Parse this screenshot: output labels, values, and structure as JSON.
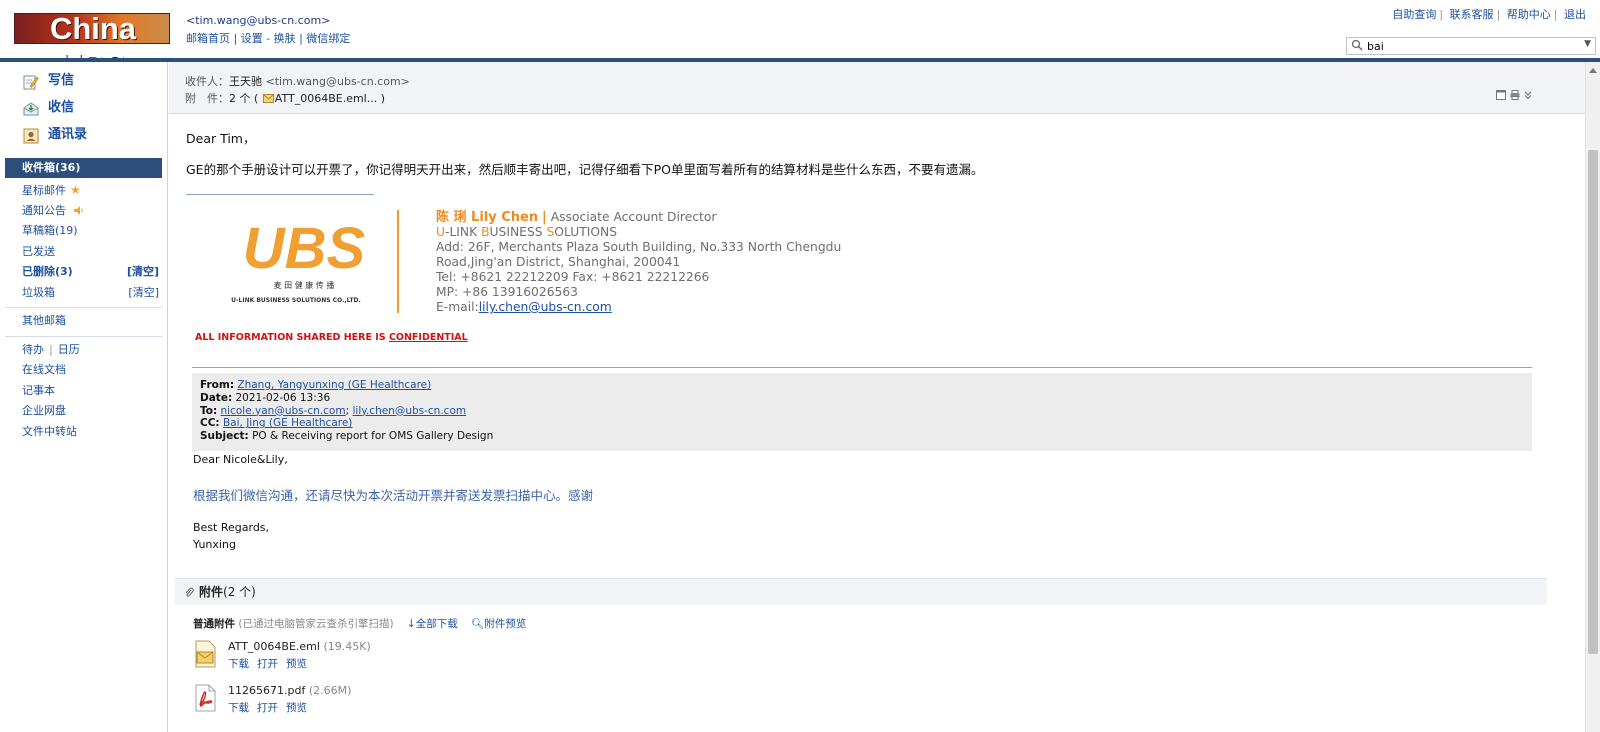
{
  "header": {
    "logo_text": "China UBS",
    "account_email": "<tim.wang@ubs-cn.com>",
    "account_links": [
      "邮箱首页",
      "设置",
      "换肤",
      "微信绑定"
    ],
    "top_links": [
      "自助查询",
      "联系客服",
      "帮助中心",
      "退出"
    ],
    "search": {
      "value": "bai"
    }
  },
  "sidebar": {
    "main": [
      "写信",
      "收信",
      "通讯录"
    ],
    "inbox": "收件箱(36)",
    "folders": [
      {
        "label": "星标邮件"
      },
      {
        "label": "通知公告"
      },
      {
        "label": "草稿箱(19)"
      },
      {
        "label": "已发送"
      },
      {
        "label": "已删除(3)",
        "clear": "[清空]"
      },
      {
        "label": "垃圾箱",
        "clear": "[清空]"
      }
    ],
    "others": "其他邮箱",
    "tools": {
      "todo": "待办",
      "calendar": "日历",
      "docs": "在线文档",
      "notes": "记事本",
      "disk": "企业网盘",
      "transfer": "文件中转站"
    }
  },
  "mail": {
    "recipient_label": "收件人：",
    "recipient_name": "王天驰",
    "recipient_email": "<tim.wang@ubs-cn.com>",
    "attachment_label": "附　件：",
    "attachment_count": "2 个 (",
    "attachment_name": "ATT_0064BE.eml...",
    "attachment_close": ")",
    "greeting": "Dear Tim，",
    "body": "GE的那个手册设计可以开票了，你记得明天开出来，然后顺丰寄出吧，记得仔细看下PO单里面写着所有的结算材料是些什么东西，不要有遗漏。",
    "signature": {
      "name": "陈 琍 Lily Chen",
      "sep": "|",
      "title": "Associate Account Director",
      "company_parts": [
        "U",
        "-LINK ",
        "B",
        "USINESS ",
        "S",
        "OLUTIONS"
      ],
      "address1": "Add:  26F,  Merchants  Plaza  South  Building,  No.333  North  Chengdu",
      "address2": "Road,Jing'an District, Shanghai, 200041",
      "tel": "Tel: +8621 22212209  Fax: +8621 22212266",
      "mp": "MP: +86 13916026563",
      "email_label": "E-mail:",
      "email": "lily.chen@ubs-cn.com",
      "logo_text": "UBS",
      "logo_cn": "麦 田 健 康 传 播",
      "logo_en": "U-LINK BUSINESS SOLUTIONS CO.,LTD."
    },
    "confidential_prefix": "ALL INFORMATION SHARED HERE IS ",
    "confidential_word": "CONFIDENTIAL",
    "quoted": {
      "from_label": "From:",
      "from": "Zhang, Yangyunxing (GE Healthcare)",
      "date_label": "Date:",
      "date": "2021-02-06 13:36",
      "to_label": "To:",
      "to1": "nicole.yan@ubs-cn.com",
      "to2": "lily.chen@ubs-cn.com",
      "cc_label": "CC:",
      "cc": "Bai, Jing (GE Healthcare)",
      "subject_label": "Subject:",
      "subject": "PO & Receiving report for OMS Gallery Design",
      "greeting": "Dear Nicole&Lily,",
      "body": "根据我们微信沟通，还请尽快为本次活动开票并寄送发票扫描中心。感谢",
      "regards": "Best Regards,",
      "sender": "Yunxing"
    }
  },
  "attachments": {
    "title": "附件",
    "count": "(2 个)",
    "section_label": "普通附件",
    "scan_note": "(已通过电脑管家云查杀引擎扫描)",
    "download_all": "全部下载",
    "preview_all": "附件预览",
    "files": [
      {
        "name": "ATT_0064BE.eml",
        "size": "(19.45K)",
        "actions": [
          "下载",
          "打开",
          "预览"
        ]
      },
      {
        "name": "11265671.pdf",
        "size": "(2.66M)",
        "actions": [
          "下载",
          "打开",
          "预览"
        ]
      }
    ]
  },
  "colors": {
    "brand_orange": "#f08a1e",
    "nav_blue": "#2b4f7a",
    "link": "#1e50a2",
    "confidential": "#d21212"
  }
}
